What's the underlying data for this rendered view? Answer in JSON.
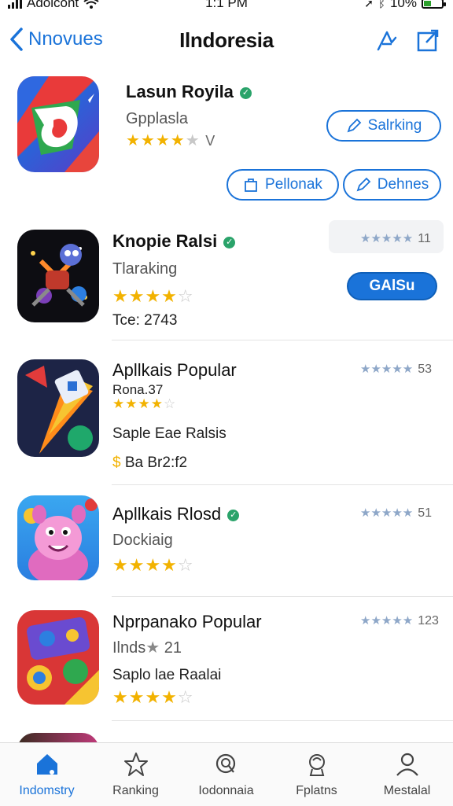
{
  "status": {
    "carrier": "Adolcont",
    "time": "1:1 PM",
    "battery": "10%"
  },
  "nav": {
    "back_label": "Nnovues",
    "title": "Ilndoresia"
  },
  "apps": [
    {
      "name": "Lasun Royila",
      "subtitle": "Gpplasla",
      "rating_suffix": "V",
      "stars_on": 4,
      "btn1": "Salrking",
      "btn2": "Pellonak",
      "btn3": "Dehnes"
    },
    {
      "name": "Knopie Ralsi",
      "subtitle": "Tlaraking",
      "meta": "Tce: 2743",
      "stars_on": 4,
      "side_count": "11",
      "action": "GAlSu"
    },
    {
      "name": "Apllkais Popular",
      "subtitle": "Rona.37",
      "meta1": "Saple Eae Ralsis",
      "meta2": "Ba Br2:f2",
      "stars_on": 4,
      "side_count": "53"
    },
    {
      "name": "Apllkais Rlosd",
      "subtitle": "Dockiaig",
      "stars_on": 4,
      "side_count": "51"
    },
    {
      "name": "Nprpanako Popular",
      "subtitle": "Ilnds",
      "subtitle_num": "21",
      "meta1": "Saplo lae Raalai",
      "stars_on": 4,
      "side_count": "123"
    }
  ],
  "tabs": [
    {
      "label": "Indomstry",
      "icon": "home-icon"
    },
    {
      "label": "Ranking",
      "icon": "star-icon"
    },
    {
      "label": "Iodonnaia",
      "icon": "search-icon"
    },
    {
      "label": "Fplatns",
      "icon": "gift-icon"
    },
    {
      "label": "Mestalal",
      "icon": "person-icon"
    }
  ],
  "colors": {
    "accent": "#1a73d9",
    "star": "#f2b200",
    "verified": "#2aa36a"
  }
}
